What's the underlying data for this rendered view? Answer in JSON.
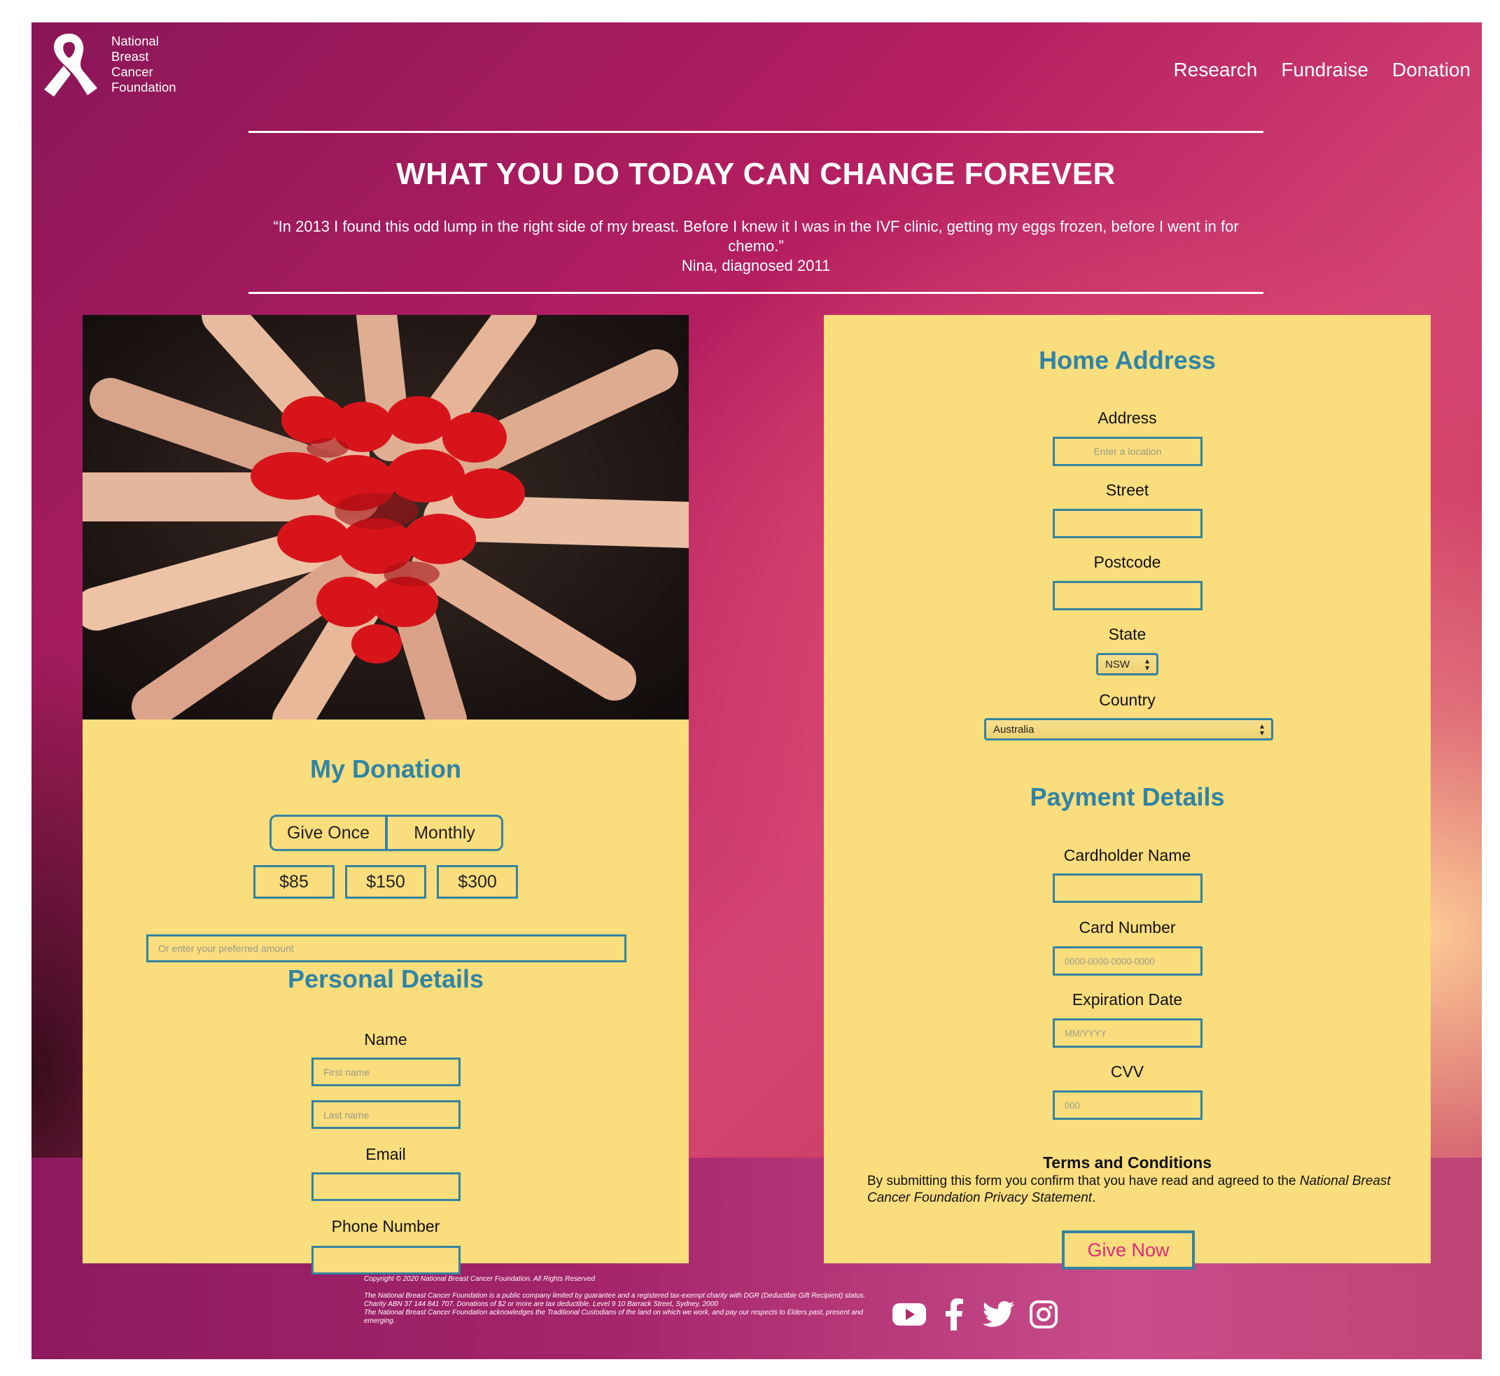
{
  "brand": {
    "name_lines": [
      "National",
      "Breast",
      "Cancer",
      "Foundation"
    ]
  },
  "nav": {
    "items": [
      "Research",
      "Fundraise",
      "Donation"
    ]
  },
  "hero": {
    "title": "WHAT YOU DO TODAY CAN CHANGE FOREVER",
    "quote": "“In 2013 I found this odd lump in the right side of my breast. Before I knew it I was in the IVF clinic, getting my eggs frozen, before I went in for chemo.”",
    "attribution": "Nina, diagnosed 2011"
  },
  "donation": {
    "heading": "My Donation",
    "frequency_options": [
      "Give Once",
      "Monthly"
    ],
    "amounts": [
      "$85",
      "$150",
      "$300"
    ],
    "custom_amount_placeholder": "Or enter your preferred amount"
  },
  "personal": {
    "heading": "Personal Details",
    "name_label": "Name",
    "first_name_placeholder": "First name",
    "last_name_placeholder": "Last name",
    "email_label": "Email",
    "phone_label": "Phone Number"
  },
  "address": {
    "heading": "Home Address",
    "address_label": "Address",
    "address_placeholder": "Enter a location",
    "street_label": "Street",
    "postcode_label": "Postcode",
    "state_label": "State",
    "state_value": "NSW",
    "country_label": "Country",
    "country_value": "Australia"
  },
  "payment": {
    "heading": "Payment Details",
    "cardholder_label": "Cardholder Name",
    "card_number_label": "Card Number",
    "card_number_placeholder": "0000-0000-0000-0000",
    "expiry_label": "Expiration Date",
    "expiry_placeholder": "MM/YYYY",
    "cvv_label": "CVV",
    "cvv_placeholder": "000"
  },
  "terms": {
    "title": "Terms and Conditions",
    "text_plain": "By submitting this form you confirm that you have read and agreed to the ",
    "text_italic": "National Breast Cancer Foundation Privacy Statement",
    "text_end": "."
  },
  "submit": {
    "label": "Give Now"
  },
  "footer": {
    "copyright": "Copyright © 2020 National Breast Cancer Foundation. All Rights Reserved",
    "lines": [
      "The National Breast Cancer Foundation is a public company limited by guarantee and a registered tax-exempt charity with DGR (Deductible Gift Recipient) status.",
      "Charity ABN 37 144 841 707. Donations of $2 or more are tax deductible. Level 9 10 Barrack Street, Sydney, 2000",
      "The National Breast Cancer Foundation acknowledges the Traditional Custodians of the land on which we work, and pay our respects to Elders past, present and emerging."
    ],
    "social_icons": [
      "youtube-icon",
      "facebook-icon",
      "twitter-icon",
      "instagram-icon"
    ]
  },
  "colors": {
    "panel": "#fadd7d",
    "accent_blue": "#3583a0",
    "heading_blue": "#2f84a6",
    "give_now_text": "#e0297a"
  }
}
